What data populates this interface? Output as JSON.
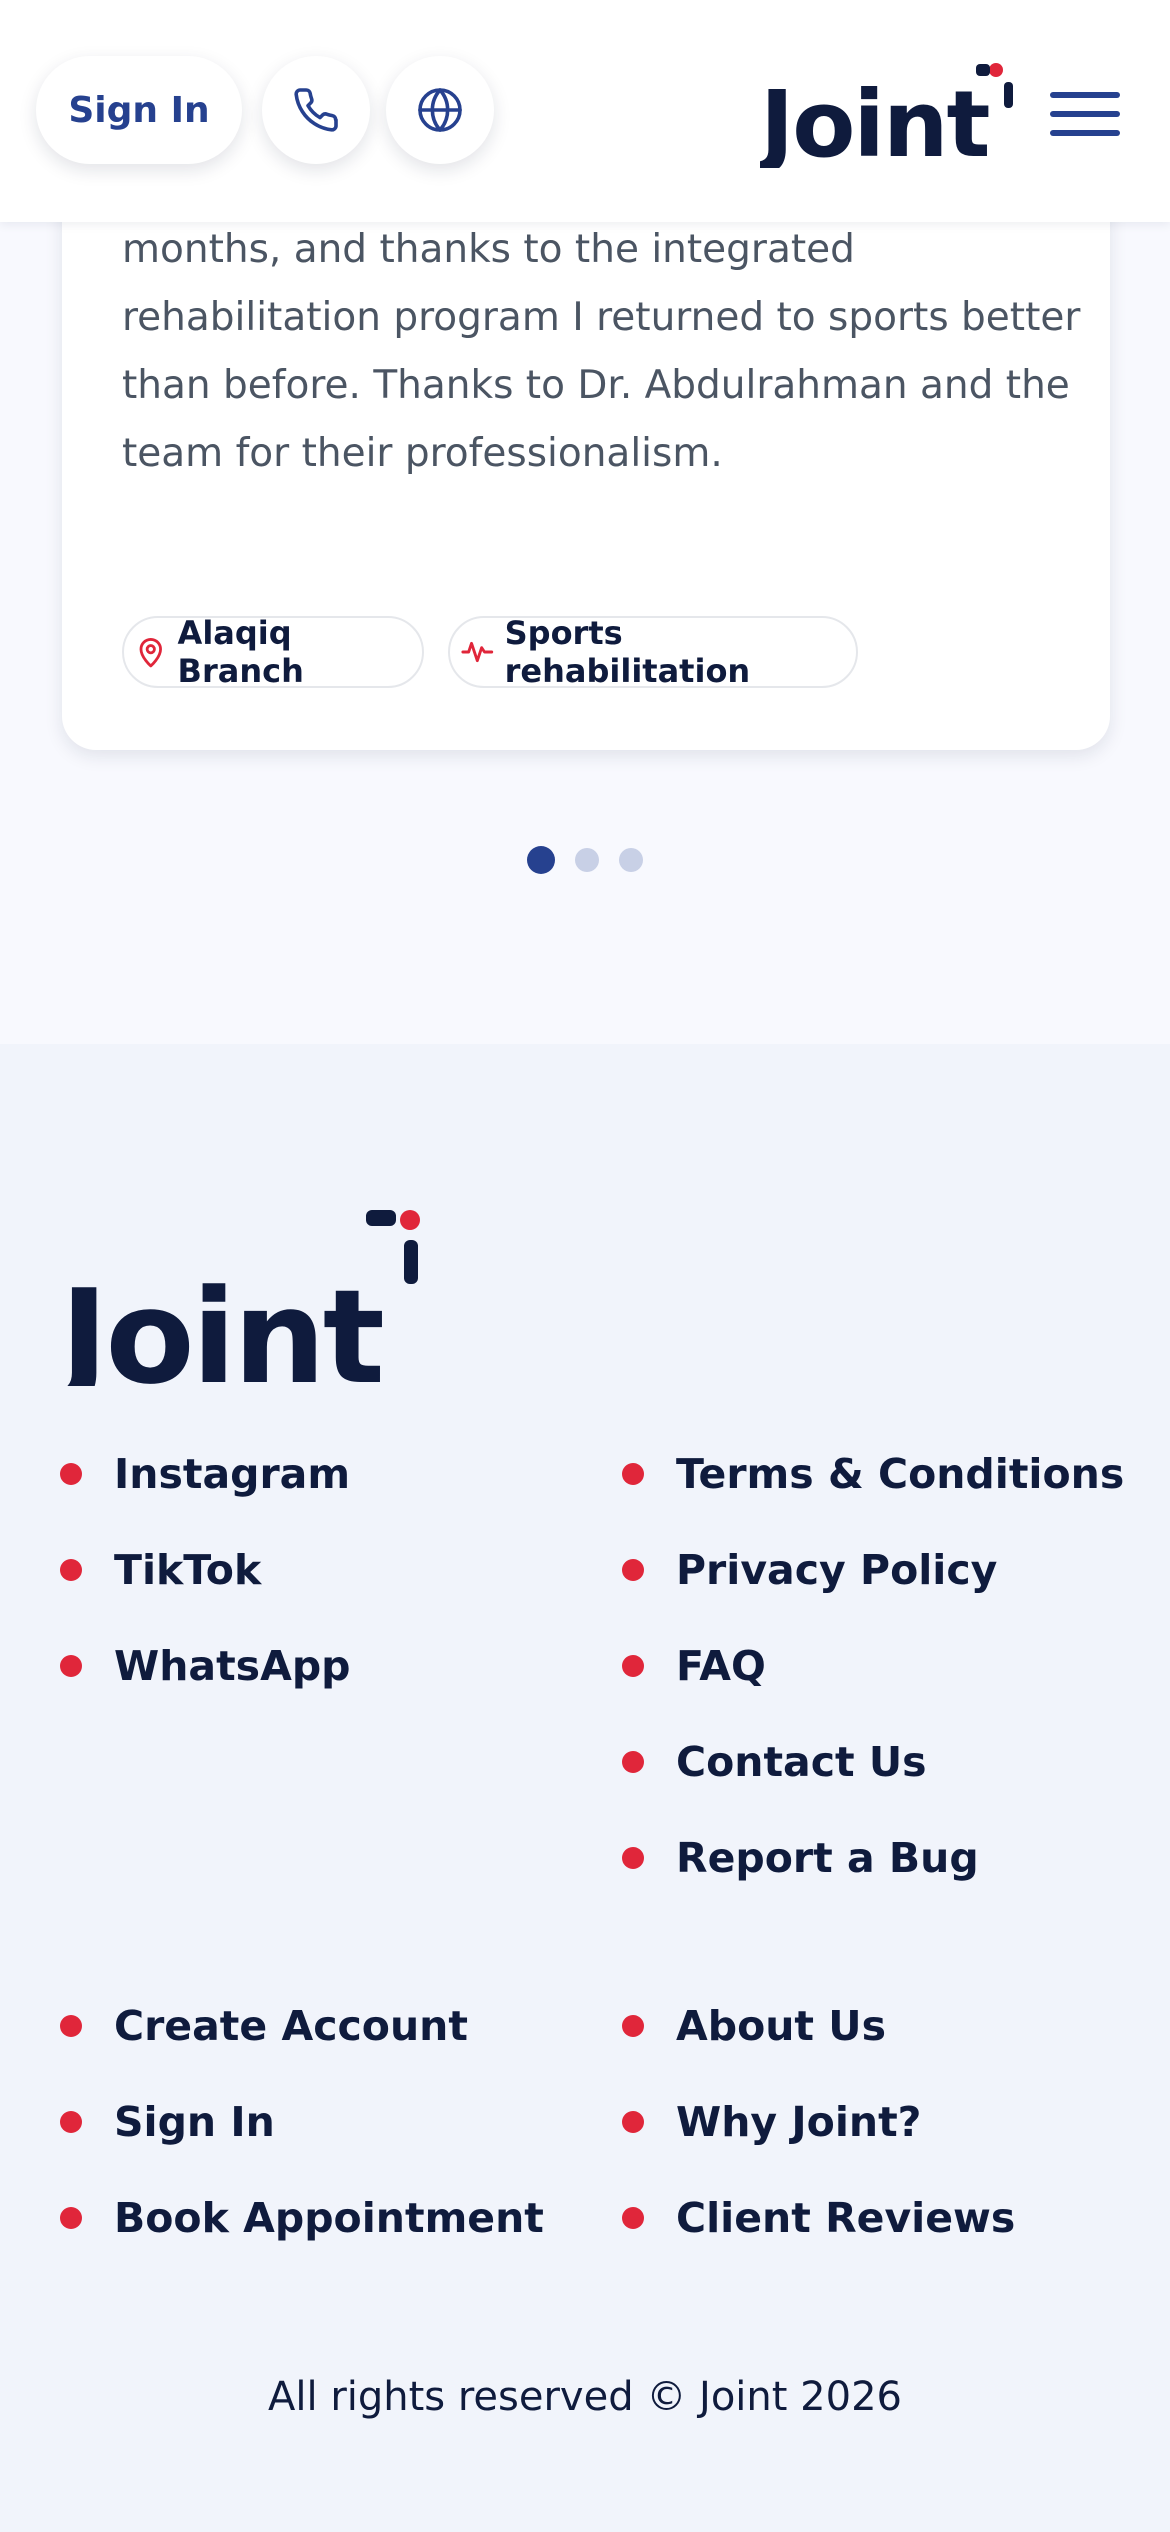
{
  "header": {
    "signin_label": "Sign In",
    "phone_icon": "phone-icon",
    "globe_icon": "globe-icon",
    "logo_text": "Joint",
    "menu_icon": "hamburger-menu-icon"
  },
  "testimonial": {
    "text": "months, and thanks to the integrated rehabilitation program I returned to sports better than before. Thanks to Dr. Abdulrahman and the team for their professionalism.",
    "tags": [
      {
        "icon": "location-pin-icon",
        "label": "Alaqiq Branch"
      },
      {
        "icon": "pulse-icon",
        "label": "Sports rehabilitation"
      }
    ],
    "pagination": {
      "count": 3,
      "active": 1
    }
  },
  "footer": {
    "logo_text": "Joint",
    "col1": [
      "Instagram",
      "TikTok",
      "WhatsApp"
    ],
    "col2": [
      "Terms & Conditions",
      "Privacy Policy",
      "FAQ",
      "Contact Us",
      "Report a Bug"
    ],
    "col3": [
      "Create Account",
      "Sign In",
      "Book Appointment"
    ],
    "col4": [
      "About Us",
      "Why Joint?",
      "Client Reviews"
    ],
    "copyright": "All rights reserved © Joint 2026"
  },
  "colors": {
    "brand_navy": "#0f1b3d",
    "brand_blue": "#26418f",
    "accent_red": "#e0263a"
  }
}
